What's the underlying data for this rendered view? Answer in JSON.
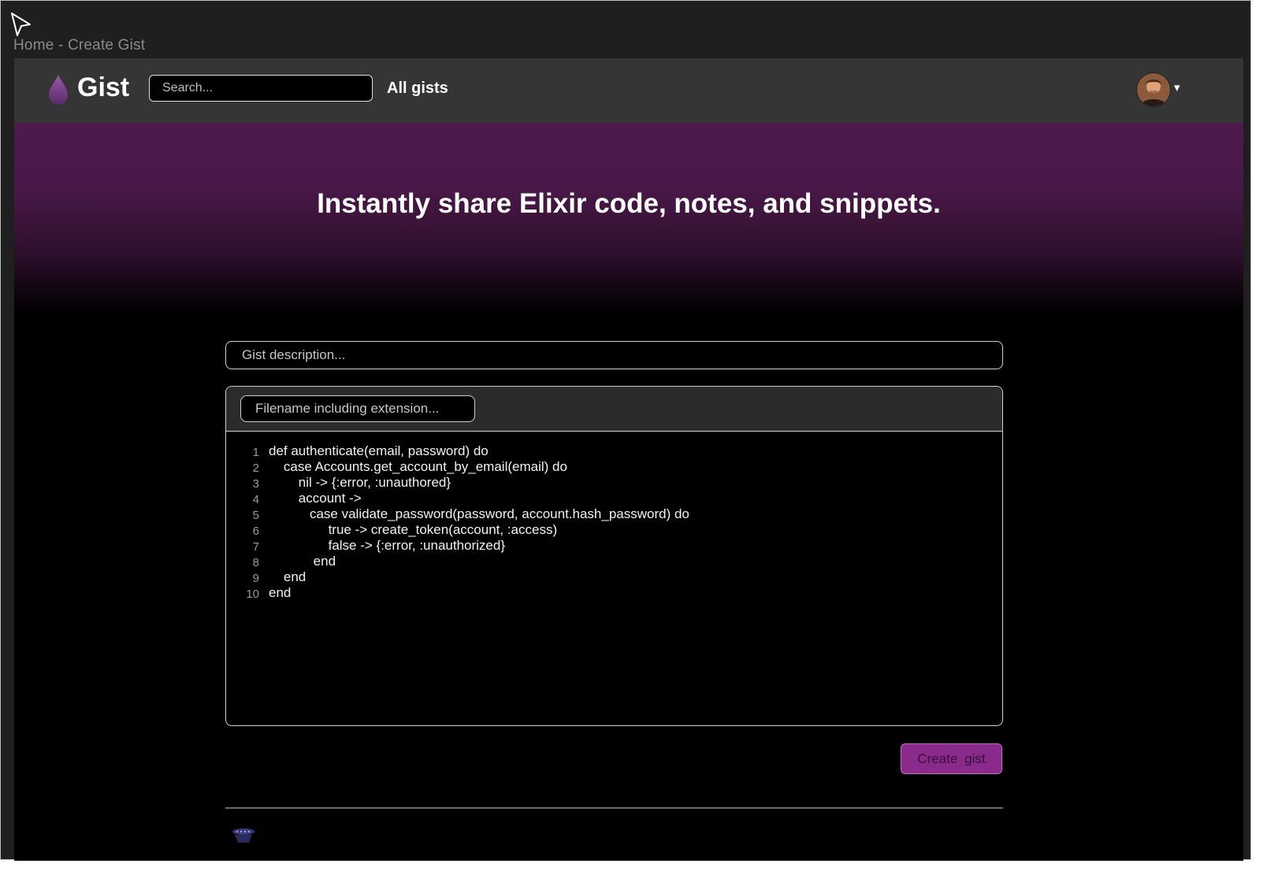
{
  "window": {
    "breadcrumb": "Home - Create Gist"
  },
  "navbar": {
    "logo_text": "Gist",
    "search_placeholder": "Search...",
    "all_gists_label": "All gists",
    "avatar_caret": "▾"
  },
  "hero": {
    "title": "Instantly share Elixir code, notes, and snippets."
  },
  "form": {
    "description_placeholder": "Gist description...",
    "filename_placeholder": "Filename including extension...",
    "create_label": "Create gist"
  },
  "code": {
    "lines": [
      {
        "num": "1",
        "text": "def authenticate(email, password) do"
      },
      {
        "num": "2",
        "text": "    case Accounts.get_account_by_email(email) do"
      },
      {
        "num": "3",
        "text": "        nil -> {:error, :unauthored}"
      },
      {
        "num": "4",
        "text": "        account ->"
      },
      {
        "num": "5",
        "text": "           case validate_password(password, account.hash_password) do"
      },
      {
        "num": "6",
        "text": "                true -> create_token(account, :access)"
      },
      {
        "num": "7",
        "text": "                false -> {:error, :unauthorized}"
      },
      {
        "num": "8",
        "text": "            end"
      },
      {
        "num": "9",
        "text": "    end"
      },
      {
        "num": "10",
        "text": "end"
      }
    ]
  },
  "colors": {
    "accent": "#8a2a8a",
    "hero": "#4f1a4c",
    "navbar": "#353535"
  }
}
